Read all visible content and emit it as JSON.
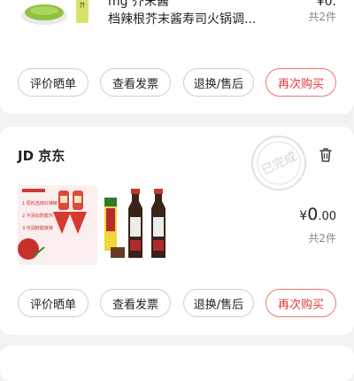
{
  "orders": [
    {
      "description": "档辣根芥末酱寿司火锅调...",
      "description_partial": "mg 芥末酱",
      "price_partial": "¥0.",
      "quantity": "共2件",
      "buttons": [
        "评价晒单",
        "查看发票",
        "退换/售后",
        "再次购买"
      ]
    },
    {
      "store_prefix": "JD",
      "store": "京东",
      "status_stamp": "已完成",
      "price_symbol": "¥",
      "price_int": "0",
      "price_dec": ".00",
      "quantity": "共2件",
      "thumb_labels": [
        "1 原料选用红辣椒",
        "2 不添加防腐剂",
        "3 可调鲜甜爽辣"
      ],
      "buttons": [
        "评价晒单",
        "查看发票",
        "退换/售后",
        "再次购买"
      ]
    }
  ],
  "colors": {
    "accent": "#e4393c",
    "background": "#f2f2f2"
  }
}
